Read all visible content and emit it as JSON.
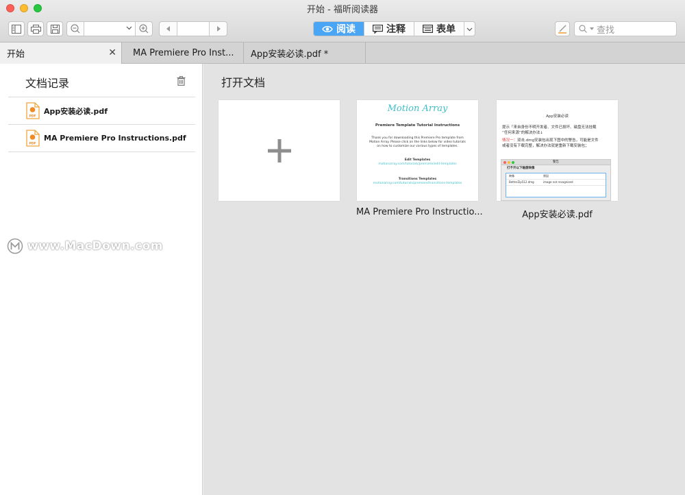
{
  "window": {
    "title": "开始 - 福昕阅读器"
  },
  "toolbar": {
    "modes": [
      {
        "label": "阅读",
        "icon": "eye-icon",
        "active": true
      },
      {
        "label": "注释",
        "icon": "comment-icon",
        "active": false
      },
      {
        "label": "表单",
        "icon": "form-icon",
        "active": false
      }
    ],
    "search_placeholder": "查找",
    "accent": "#4aa5f5"
  },
  "tabs": [
    {
      "label": "开始",
      "active": true,
      "closable": true
    },
    {
      "label": "MA Premiere Pro Inst...",
      "active": false
    },
    {
      "label": "App安装必读.pdf *",
      "active": false
    }
  ],
  "sidebar": {
    "title": "文档记录",
    "records": [
      {
        "name": "App安装必读.pdf"
      },
      {
        "name": "MA Premiere Pro Instructions.pdf"
      }
    ]
  },
  "watermark": "www.MacDown.com",
  "main": {
    "title": "打开文档",
    "cards": [
      {
        "caption": "MA Premiere Pro Instructio..."
      },
      {
        "caption": "App安装必读.pdf"
      }
    ],
    "thumb1": {
      "logo": "Motion Array",
      "heading": "Premiere Template Tutorial Instructions",
      "para1": "Thank you for downloading this Premiere Pro template from",
      "para2": "Motion Array. Please click on the links below for video tutorials",
      "para3": "on how to customize our various types of templates.",
      "sec1": "Edit Templates",
      "link1": "motionarray.com/tutorials/premiere/edit-templates",
      "sec2": "Transitions Templates",
      "link2": "motionarray.com/tutorials/premiere/transitions-templates"
    },
    "thumb2": {
      "title": "App安装必读",
      "line1": "提示「来自身份不明开发者、文件已损坏、磁盘无法挂载",
      "line2": "“任何来源”的解决办法↓",
      "red": "情况一：",
      "line3": "双击.dmg安装包出现下图中的警告，可能是文件",
      "line4": "或者没有下载完整，解决办法就是重新下载安装包；",
      "dlg_title": "警告",
      "dlg_heading": "打不开以下磁盘映像",
      "col1": "映像",
      "col2": "原因",
      "cell1": "BetterZip512.dmg",
      "cell2": "image not recognized"
    }
  }
}
